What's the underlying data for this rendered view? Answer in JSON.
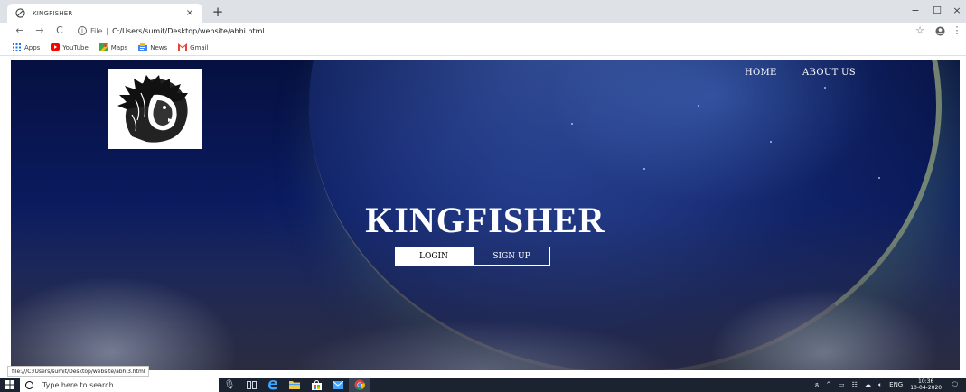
{
  "browser": {
    "tab_title": "KINGFISHER",
    "tab_close": "×",
    "new_tab": "+",
    "window_controls": {
      "minimize": "−",
      "maximize": "☐",
      "close": "×"
    },
    "nav": {
      "back": "←",
      "forward": "→",
      "reload": "C"
    },
    "omnibox": {
      "info": "i",
      "scheme_label": "File",
      "separator": "|",
      "url": "C:/Users/sumit/Desktop/website/abhi.html"
    },
    "star": "☆",
    "bookmarks": [
      {
        "label": "Apps",
        "icon": "apps-grid-icon"
      },
      {
        "label": "YouTube",
        "icon": "youtube-icon"
      },
      {
        "label": "Maps",
        "icon": "maps-icon"
      },
      {
        "label": "News",
        "icon": "news-icon"
      },
      {
        "label": "Gmail",
        "icon": "gmail-icon"
      }
    ],
    "status_url": "file:///C:/Users/sumit/Desktop/website/abhi3.html"
  },
  "page": {
    "nav": {
      "home": "HOME",
      "about": "ABOUT US"
    },
    "brand": "KINGFISHER",
    "buttons": {
      "login": "LOGIN",
      "signup": "SIGN UP"
    },
    "logo_icon": "lion-head-icon"
  },
  "taskbar": {
    "search_placeholder": "Type here to search",
    "tray_lang": "ENG",
    "time": "10:36",
    "date": "10-04-2020"
  },
  "colors": {
    "hero_dark": "#061040",
    "hero_mid": "#0a1a5e",
    "taskbar": "#1b2330",
    "tab_strip": "#dee1e6"
  }
}
